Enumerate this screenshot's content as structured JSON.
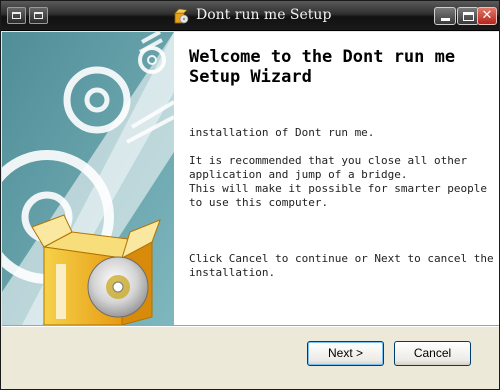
{
  "window": {
    "title": "Dont run me Setup",
    "icon": "installer-box-icon",
    "controls": [
      "minimize-icon",
      "maximize-icon",
      "close-icon"
    ]
  },
  "wizard": {
    "heading": "Welcome to the Dont run me Setup Wizard",
    "paragraphs": [
      "installation of Dont run me.",
      "It is recommended that you close all other application and jump of a bridge.\nThis will make it possible for smarter people to use this computer.",
      "Click Cancel to continue or Next to cancel the installation."
    ]
  },
  "buttons": {
    "next": "Next >",
    "cancel": "Cancel"
  },
  "colors": {
    "banner_teal": "#5d9ba4",
    "title_bar": "#1a1a1a",
    "dialog_face": "#ece9d8",
    "close_red": "#c8412f"
  }
}
